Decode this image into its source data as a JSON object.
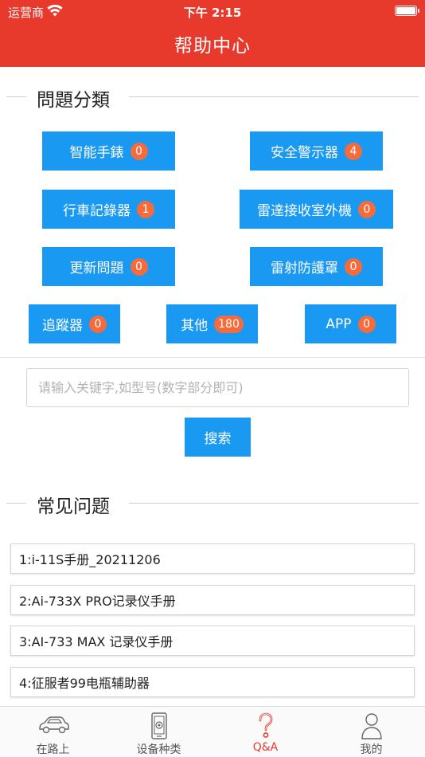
{
  "status_bar": {
    "carrier": "运营商",
    "time": "下午 2:15"
  },
  "header": {
    "title": "帮助中心"
  },
  "categories_section": {
    "title": "問題分類"
  },
  "categories": [
    {
      "label": "智能手錶",
      "count": "0"
    },
    {
      "label": "安全警示器",
      "count": "4"
    },
    {
      "label": "行車記錄器",
      "count": "1"
    },
    {
      "label": "雷達接收室外機",
      "count": "0"
    },
    {
      "label": "更新問題",
      "count": "0"
    },
    {
      "label": "雷射防護罩",
      "count": "0"
    },
    {
      "label": "追蹤器",
      "count": "0"
    },
    {
      "label": "其他",
      "count": "180"
    },
    {
      "label": "APP",
      "count": "0"
    }
  ],
  "search": {
    "placeholder": "请输入关键字,如型号(数字部分即可)",
    "value": "",
    "button_label": "搜索"
  },
  "faq_section": {
    "title": "常见问题"
  },
  "faq": [
    {
      "label": "1:i-11S手册_20211206"
    },
    {
      "label": "2:Ai-733X PRO记录仪手册"
    },
    {
      "label": "3:AI-733 MAX 记录仪手册"
    },
    {
      "label": "4:征服者99电瓶辅助器"
    }
  ],
  "tabbar": {
    "active": "Q&A",
    "tabs": [
      {
        "label": "在路上",
        "icon": "car-icon"
      },
      {
        "label": "设备种类",
        "icon": "device-icon"
      },
      {
        "label": "Q&A",
        "icon": "question-icon"
      },
      {
        "label": "我的",
        "icon": "person-icon"
      }
    ]
  },
  "colors": {
    "brand_red": "#e8392d",
    "button_blue": "#1a99f3",
    "badge_orange": "#f56b3c"
  }
}
